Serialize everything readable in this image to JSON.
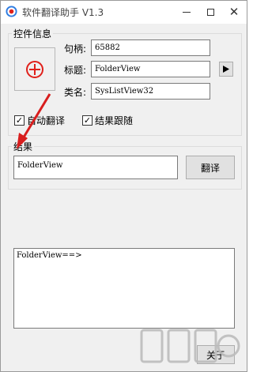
{
  "window": {
    "title": "软件翻译助手 V1.3"
  },
  "control_group": {
    "legend": "控件信息",
    "handle_label": "句柄:",
    "handle_value": "65882",
    "caption_label": "标题:",
    "caption_value": "FolderView",
    "class_label": "类名:",
    "class_value": "SysListView32"
  },
  "options": {
    "auto_translate_label": "自动翻译",
    "auto_translate_checked": true,
    "follow_result_label": "结果跟随",
    "follow_result_checked": true
  },
  "result_group": {
    "legend": "结果",
    "result_value": "FolderView",
    "translate_button": "翻译",
    "log_text": "FolderView==>"
  },
  "footer": {
    "close_button": "关于"
  },
  "colors": {
    "crosshair": "#e0201a",
    "arrow": "#d81e1e"
  }
}
